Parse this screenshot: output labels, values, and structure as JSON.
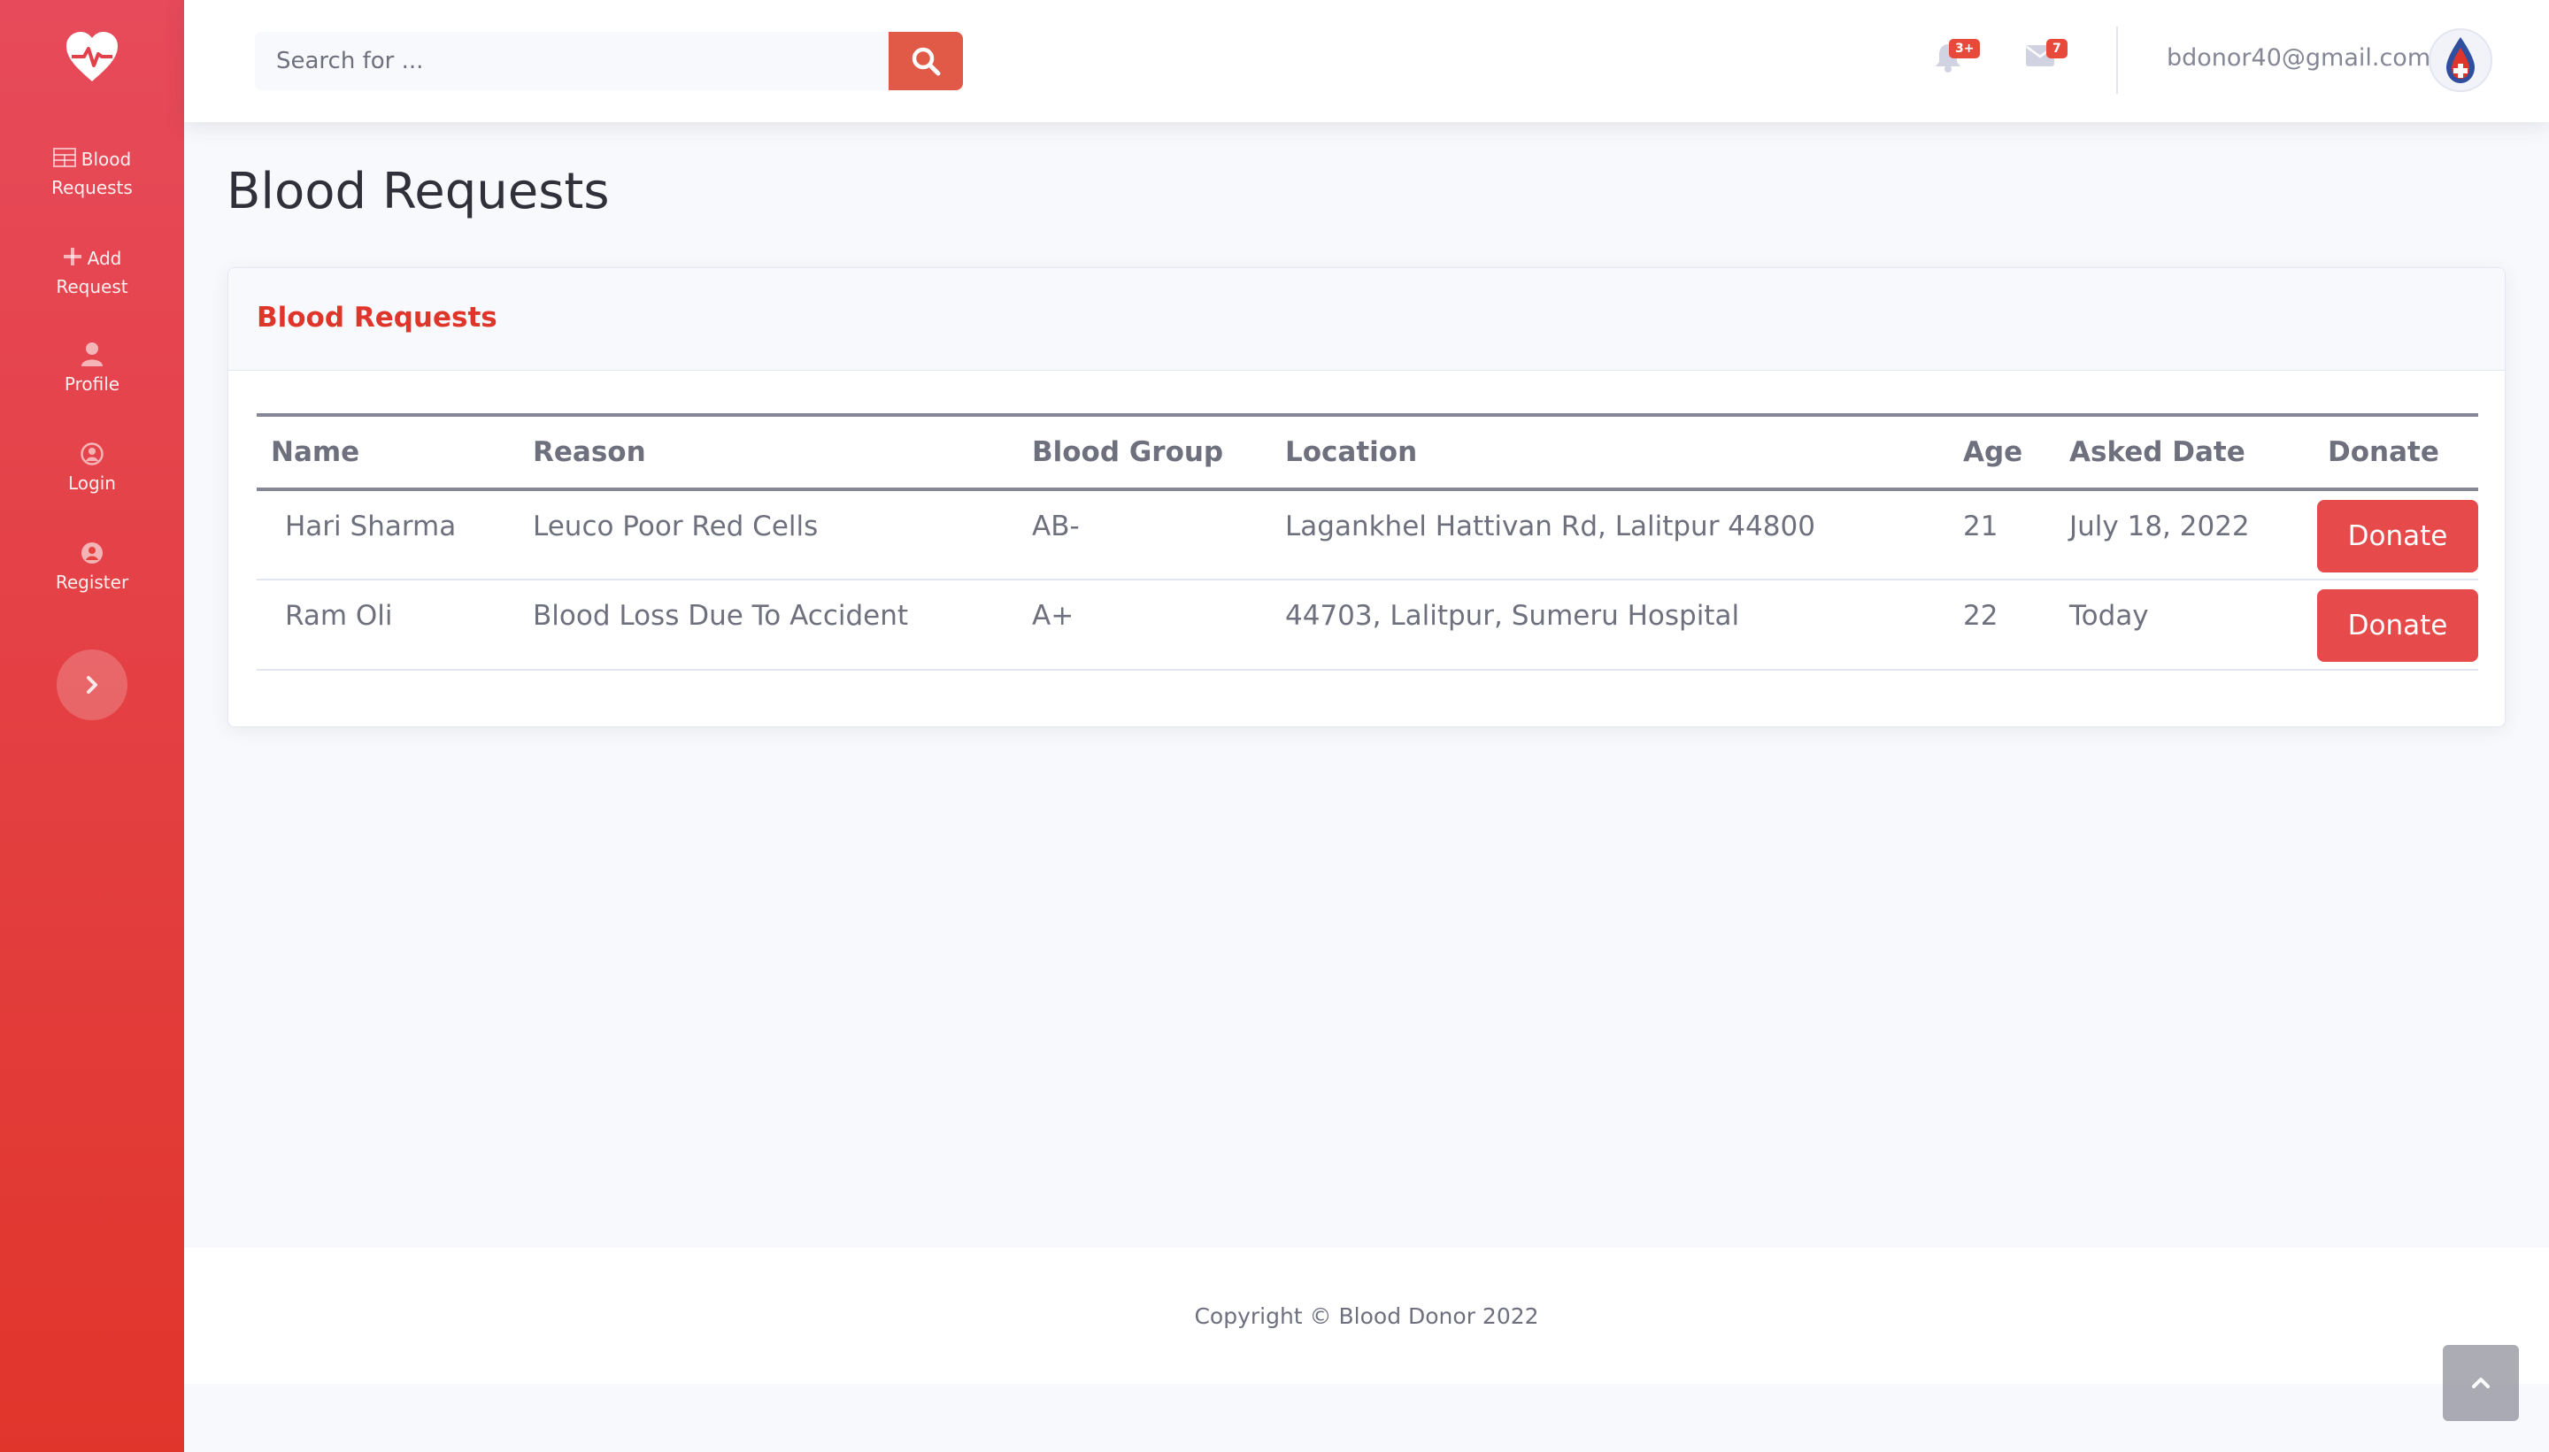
{
  "sidebar": {
    "brand_icon": "heartbeat-icon",
    "items": [
      {
        "label_line1": "Blood",
        "label_line2": "Requests",
        "icon": "table-icon"
      },
      {
        "label_line1": "Add",
        "label_line2": "Request",
        "icon": "plus-icon"
      },
      {
        "label": "Profile",
        "icon": "user-icon"
      },
      {
        "label": "Login",
        "icon": "user-circle-icon"
      },
      {
        "label": "Register",
        "icon": "user-circle-icon"
      }
    ],
    "toggle_icon": "chevron-right-icon"
  },
  "topbar": {
    "search": {
      "placeholder": "Search for ...",
      "value": ""
    },
    "alerts_badge": "3+",
    "messages_badge": "7",
    "user_email": "bdonor40@gmail.com"
  },
  "main": {
    "page_title": "Blood Requests",
    "card_title": "Blood Requests",
    "table": {
      "columns": [
        "Name",
        "Reason",
        "Blood Group",
        "Location",
        "Age",
        "Asked Date",
        "Donate"
      ],
      "rows": [
        {
          "name": "Hari Sharma",
          "reason": "Leuco Poor Red Cells",
          "blood_group": "AB-",
          "location": "Lagankhel Hattivan Rd, Lalitpur 44800",
          "age": "21",
          "asked_date": "July 18, 2022",
          "action": "Donate"
        },
        {
          "name": "Ram Oli",
          "reason": "Blood Loss Due To Accident",
          "blood_group": "A+",
          "location": "44703, Lalitpur, Sumeru Hospital",
          "age": "22",
          "asked_date": "Today",
          "action": "Donate"
        }
      ]
    }
  },
  "footer": {
    "copyright": "Copyright © Blood Donor 2022"
  },
  "colors": {
    "sidebar_top": "#e74a5a",
    "sidebar_bottom": "#e0352b",
    "accent": "#e74a4a",
    "card_title": "#e0352b"
  }
}
